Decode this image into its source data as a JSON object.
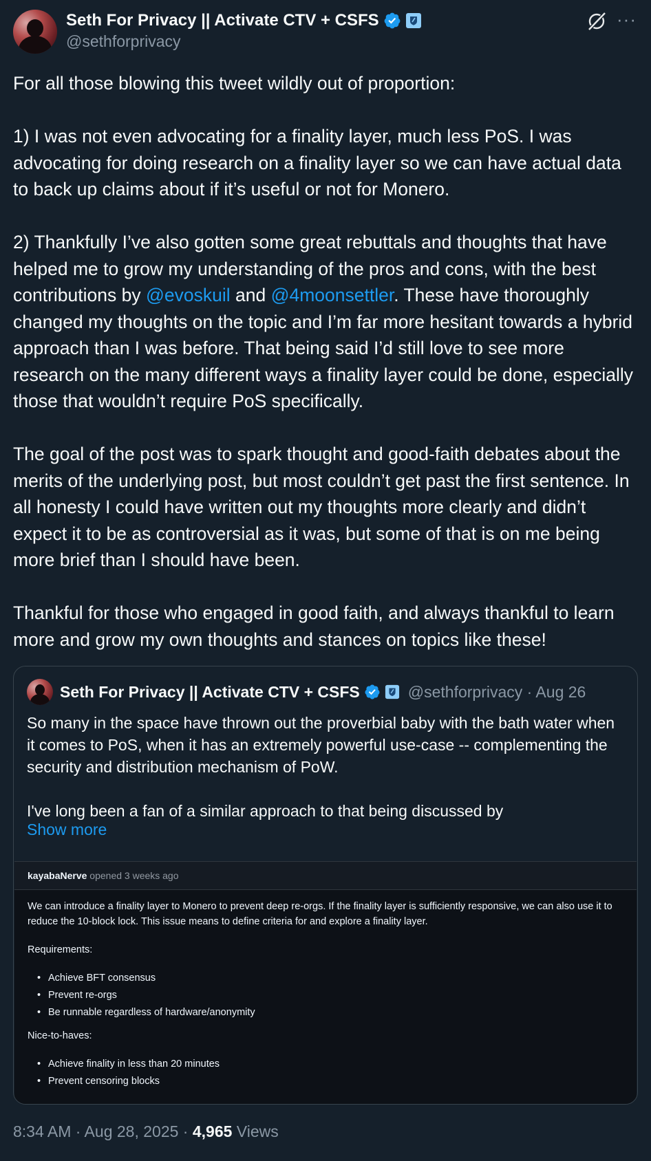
{
  "author": {
    "name": "Seth For Privacy || Activate CTV + CSFS",
    "handle": "@sethforprivacy",
    "verified_icon": "verified-badge-icon",
    "org_icon": "affiliate-badge-icon"
  },
  "header_actions": {
    "grok_icon": "grok-icon",
    "more_icon": "more-options-icon"
  },
  "tweet": {
    "p1": "For all those blowing this tweet wildly out of proportion:",
    "p2": "1) I was not even advocating for a finality layer, much less PoS. I was advocating for doing research on a finality layer so we can have actual data to back up claims about if it’s useful or not for Monero.",
    "p3_part1": "2) Thankfully I’ve also gotten some great rebuttals and thoughts that have helped me to grow my understanding of the pros and cons, with the best contributions by ",
    "mention1": "@evoskuil",
    "p3_and": " and ",
    "mention2": "@4moonsettler",
    "p3_part2": ". These have thoroughly changed my thoughts on the topic and I’m far more hesitant towards a hybrid approach than I was before. That being said I’d still love to see more research on the many different ways a finality layer could be done, especially those that wouldn’t require PoS specifically.",
    "p4": "The goal of the post was to spark thought and good-faith debates about the merits of the underlying post, but most couldn’t get past the first sentence. In all honesty I could have written out my thoughts more clearly and didn’t expect it to be as controversial as it was, but some of that is on me being more brief than I should have been.",
    "p5": "Thankful for those who engaged in good faith, and always thankful to learn more and grow my own thoughts and stances on topics like these!"
  },
  "quote": {
    "name": "Seth For Privacy || Activate CTV + CSFS",
    "handle_date": "@sethforprivacy · Aug 26",
    "p1": "So many in the space have thrown out the proverbial baby with the bath water when it comes to PoS, when it has an extremely powerful use-case -- complementing the security and distribution mechanism of PoW.",
    "p2": "I've long been a fan of a similar approach to that being discussed by",
    "show_more": "Show more"
  },
  "github_card": {
    "user": "kayabaNerve",
    "opened": " opened 3 weeks ago",
    "body": "We can introduce a finality layer to Monero to prevent deep re-orgs. If the finality layer is sufficiently responsive, we can also use it to reduce the 10-block lock. This issue means to define criteria for and explore a finality layer.",
    "requirements_label": "Requirements:",
    "requirements": [
      "Achieve BFT consensus",
      "Prevent re-orgs",
      "Be runnable regardless of hardware/anonymity"
    ],
    "nice_label": "Nice-to-haves:",
    "nice": [
      "Achieve finality in less than 20 minutes",
      "Prevent censoring blocks"
    ]
  },
  "footer": {
    "time": "8:34 AM · Aug 28, 2025 · ",
    "views_count": "4,965",
    "views_label": " Views"
  }
}
